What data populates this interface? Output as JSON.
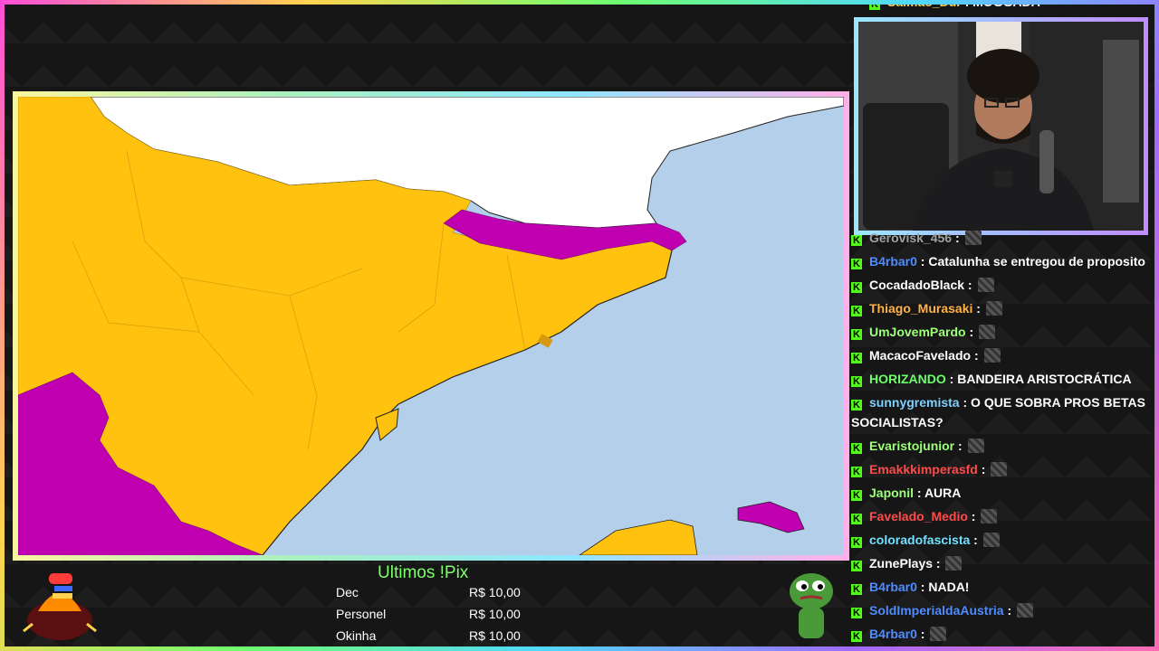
{
  "pix": {
    "title": "Ultimos !Pix",
    "rows": [
      {
        "name": "Dec",
        "amount": "R$ 10,00"
      },
      {
        "name": "Personel",
        "amount": "R$ 10,00"
      },
      {
        "name": "Okinha",
        "amount": "R$ 10,00"
      }
    ]
  },
  "chat_top": {
    "user": "Salmao_Dur",
    "message": ": MOGGADA"
  },
  "chat": [
    {
      "user": "Gerovisk_456",
      "user_color": "#a0a0a0",
      "message": " : "
    },
    {
      "user": "B4rbar0",
      "user_color": "#4f8cff",
      "message": " : Catalunha se entregou de proposito"
    },
    {
      "user": "CocadadoBlack",
      "user_color": "#ffffff",
      "message": " : "
    },
    {
      "user": "Thiago_Murasaki",
      "user_color": "#ffb347",
      "message": " : "
    },
    {
      "user": "UmJovemPardo",
      "user_color": "#9dff7a",
      "message": " : "
    },
    {
      "user": "MacacoFavelado",
      "user_color": "#ffffff",
      "message": " : "
    },
    {
      "user": "HORIZANDO",
      "user_color": "#6bff6b",
      "message": " : BANDEIRA ARISTOCRÁTICA"
    },
    {
      "user": "sunnygremista",
      "user_color": "#7fd0ff",
      "message": " : O QUE SOBRA PROS BETAS SOCIALISTAS?"
    },
    {
      "user": "Evaristojunior",
      "user_color": "#9dff7a",
      "message": " : "
    },
    {
      "user": "Emakkkimperasfd",
      "user_color": "#ff4a4a",
      "message": " : "
    },
    {
      "user": "Japonil",
      "user_color": "#9dff7a",
      "message": " : AURA"
    },
    {
      "user": "Favelado_Medio",
      "user_color": "#ff4a4a",
      "message": " : "
    },
    {
      "user": "coloradofascista",
      "user_color": "#6fe0ff",
      "message": " : "
    },
    {
      "user": "ZunePlays",
      "user_color": "#ffffff",
      "message": " : "
    },
    {
      "user": "B4rbar0",
      "user_color": "#4f8cff",
      "message": " : NADA!"
    },
    {
      "user": "SoldImperialdaAustria",
      "user_color": "#4f8cff",
      "message": " : "
    },
    {
      "user": "B4rbar0",
      "user_color": "#4f8cff",
      "message": " : "
    }
  ],
  "colors": {
    "map_sea": "#b3cfea",
    "map_yellow": "#ffc20e",
    "map_magenta": "#c000b0",
    "map_white": "#ffffff",
    "kick_green": "#53fc18"
  }
}
